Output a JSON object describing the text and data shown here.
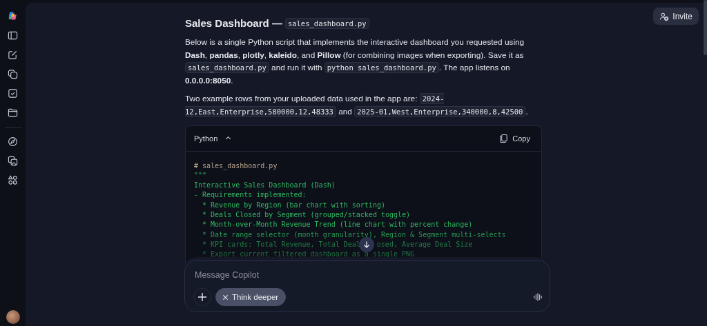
{
  "header": {
    "invite_label": "Invite"
  },
  "message": {
    "heading": [
      {
        "kind": "text",
        "text": "Sales Dashboard — "
      },
      {
        "kind": "code",
        "text": "sales_dashboard.py"
      }
    ],
    "paragraphs": [
      [
        {
          "kind": "text",
          "text": "Below is a single Python script that implements the interactive dashboard you requested using **Dash**, **pandas**, **plotly**, **kaleido**, and **Pillow** (for combining images when exporting). Save it as "
        },
        {
          "kind": "code",
          "text": "sales_dashboard.py"
        },
        {
          "kind": "text",
          "text": " and run it with "
        },
        {
          "kind": "code",
          "text": "python sales_dashboard.py"
        },
        {
          "kind": "text",
          "text": ". The app listens on **0.0.0.0:8050**."
        }
      ],
      [
        {
          "kind": "text",
          "text": "Two example rows from your uploaded data used in the app are: "
        },
        {
          "kind": "code",
          "text": "2024-12,East,Enterprise,580000,12,48333"
        },
        {
          "kind": "text",
          "text": " and "
        },
        {
          "kind": "code",
          "text": "2025-01,West,Enterprise,340000,8,42500"
        },
        {
          "kind": "text",
          "text": "."
        }
      ]
    ]
  },
  "code_block": {
    "language": "Python",
    "expanded": true,
    "copy_label": "Copy",
    "lines": [
      {
        "kind": "comment",
        "text": "# sales_dashboard.py"
      },
      {
        "kind": "string",
        "text": "\"\"\""
      },
      {
        "kind": "string",
        "text": "Interactive Sales Dashboard (Dash)"
      },
      {
        "kind": "string",
        "text": "- Requirements implemented:"
      },
      {
        "kind": "string",
        "text": "  * Revenue by Region (bar chart with sorting)"
      },
      {
        "kind": "string",
        "text": "  * Deals Closed by Segment (grouped/stacked toggle)"
      },
      {
        "kind": "string",
        "text": "  * Month-over-Month Revenue Trend (line chart with percent change)"
      },
      {
        "kind": "string",
        "text": "  * Date range selector (month granularity), Region & Segment multi-selects"
      },
      {
        "kind": "string",
        "parts": [
          "  * KPI cards: Total Revenue, Total Deal",
          "osed, Average Deal Size"
        ]
      },
      {
        "kind": "string",
        "text": "  * Export current filtered dashboard as a single PNG"
      }
    ]
  },
  "composer": {
    "placeholder": "Message Copilot",
    "chips": [
      {
        "label": "Think deeper",
        "selected": true
      }
    ]
  }
}
